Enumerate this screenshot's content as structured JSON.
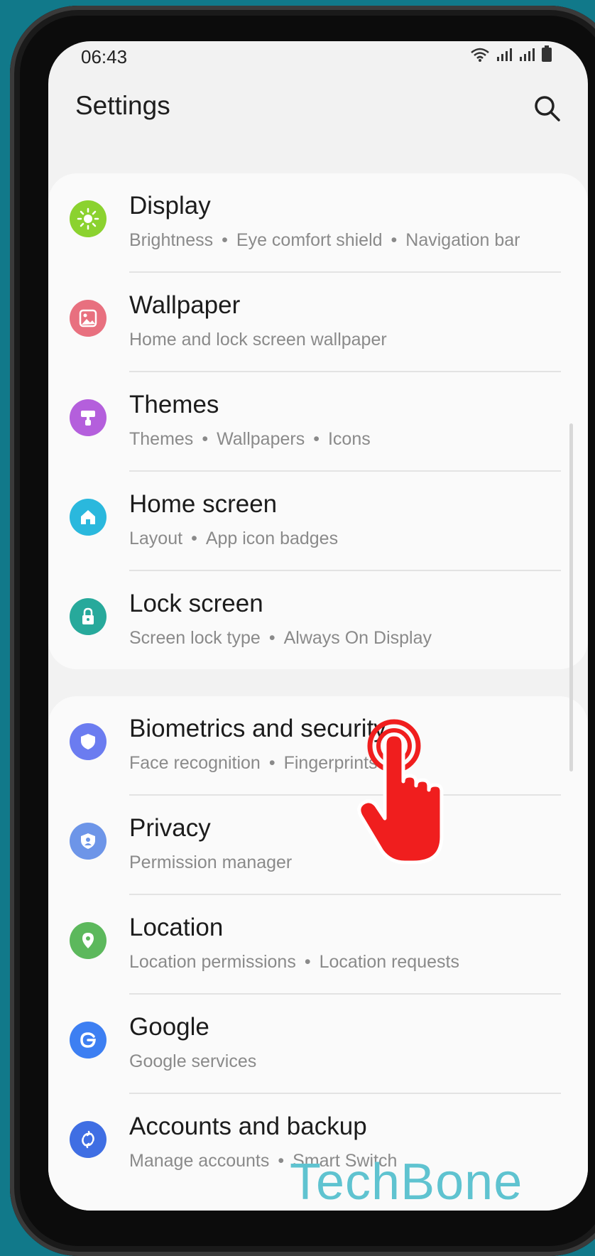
{
  "status_bar": {
    "time": "06:43"
  },
  "header": {
    "title": "Settings"
  },
  "icons": {
    "search": "search-icon"
  },
  "groups": [
    {
      "items": [
        {
          "title": "Display",
          "subtitle": [
            "Brightness",
            "Eye comfort shield",
            "Navigation bar"
          ],
          "icon": "sun-icon",
          "color": "#8bd22f"
        },
        {
          "title": "Wallpaper",
          "subtitle": [
            "Home and lock screen wallpaper"
          ],
          "icon": "image-icon",
          "color": "#e8707f"
        },
        {
          "title": "Themes",
          "subtitle": [
            "Themes",
            "Wallpapers",
            "Icons"
          ],
          "icon": "paint-roller-icon",
          "color": "#b45fdc"
        },
        {
          "title": "Home screen",
          "subtitle": [
            "Layout",
            "App icon badges"
          ],
          "icon": "home-icon",
          "color": "#2ab8dd"
        },
        {
          "title": "Lock screen",
          "subtitle": [
            "Screen lock type",
            "Always On Display"
          ],
          "icon": "lock-icon",
          "color": "#27a99b"
        }
      ]
    },
    {
      "items": [
        {
          "title": "Biometrics and security",
          "subtitle": [
            "Face recognition",
            "Fingerprints"
          ],
          "icon": "shield-icon",
          "color": "#6b7cf0"
        },
        {
          "title": "Privacy",
          "subtitle": [
            "Permission manager"
          ],
          "icon": "privacy-shield-icon",
          "color": "#6d95e8"
        },
        {
          "title": "Location",
          "subtitle": [
            "Location permissions",
            "Location requests"
          ],
          "icon": "location-pin-icon",
          "color": "#5cb85c"
        },
        {
          "title": "Google",
          "subtitle": [
            "Google services"
          ],
          "icon": "google-icon",
          "color": "#3d7ff2"
        },
        {
          "title": "Accounts and backup",
          "subtitle": [
            "Manage accounts",
            "Smart Switch"
          ],
          "icon": "sync-icon",
          "color": "#3f6ee3"
        }
      ]
    }
  ],
  "watermark": "TechBone",
  "overlay": {
    "icon": "tap-hand-icon",
    "color": "#f01e1e"
  }
}
